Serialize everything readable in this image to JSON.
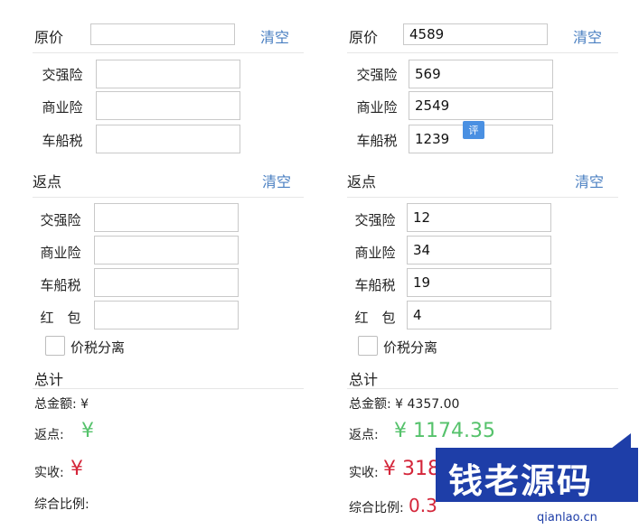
{
  "left": {
    "original_price_label": "原价",
    "original_price_value": "",
    "clear_label": "清空",
    "insurance": [
      {
        "label": "交强险",
        "value": ""
      },
      {
        "label": "商业险",
        "value": ""
      },
      {
        "label": "车船税",
        "value": ""
      }
    ],
    "rebate_section": "返点",
    "rebate_clear": "清空",
    "rebates": [
      {
        "label": "交强险",
        "value": ""
      },
      {
        "label": "商业险",
        "value": ""
      },
      {
        "label": "车船税",
        "value": ""
      },
      {
        "label": "红　包",
        "value": ""
      }
    ],
    "tax_separate_label": "价税分离",
    "summary_title": "总计",
    "total_amount_label": "总金额: ¥",
    "rebate_label": "返点:",
    "rebate_value": "¥",
    "net_label": "实收:",
    "net_value": "¥",
    "ratio_label": "综合比例:",
    "ratio_value": ""
  },
  "right": {
    "original_price_label": "原价",
    "original_price_value": "4589",
    "clear_label": "清空",
    "insurance": [
      {
        "label": "交强险",
        "value": "569"
      },
      {
        "label": "商业险",
        "value": "2549"
      },
      {
        "label": "车船税",
        "value": "1239"
      }
    ],
    "rebate_section": "返点",
    "rebate_clear": "清空",
    "rebates": [
      {
        "label": "交强险",
        "value": "12"
      },
      {
        "label": "商业险",
        "value": "34"
      },
      {
        "label": "车船税",
        "value": "19"
      },
      {
        "label": "红　包",
        "value": "4"
      }
    ],
    "tax_separate_label": "价税分离",
    "summary_title": "总计",
    "total_amount_label": "总金额: ¥ 4357.00",
    "rebate_label": "返点:",
    "rebate_value": "¥ 1174.35",
    "net_label": "实收:",
    "net_value": "¥ 318",
    "ratio_label": "综合比例:",
    "ratio_value": "0.3"
  },
  "badge": "评",
  "watermark": {
    "logo_text": "钱老源码",
    "site": "qianlao.cn"
  },
  "colors": {
    "accent": "#4a7fc1",
    "rebate_green": "#55c26b",
    "net_red": "#d4263a"
  }
}
